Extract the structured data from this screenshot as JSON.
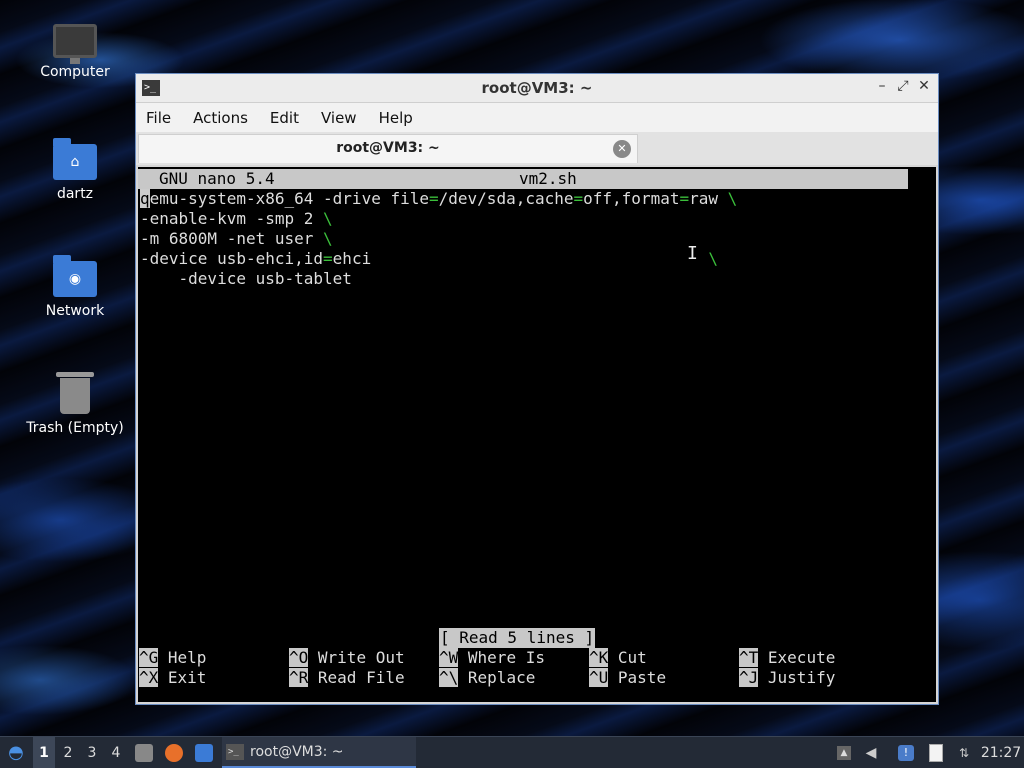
{
  "desktop": {
    "icons": [
      {
        "label": "Computer",
        "icon": "computer-icon"
      },
      {
        "label": "dartz",
        "icon": "home-folder-icon"
      },
      {
        "label": "Network",
        "icon": "network-folder-icon"
      },
      {
        "label": "Trash (Empty)",
        "icon": "trash-icon"
      }
    ]
  },
  "window": {
    "title": "root@VM3: ~",
    "controls": {
      "minimize": "–",
      "maximize": "⤢",
      "close": "✕"
    },
    "menu": [
      "File",
      "Actions",
      "Edit",
      "View",
      "Help"
    ],
    "tab": {
      "label": "root@VM3: ~",
      "close": "✕"
    }
  },
  "nano": {
    "version": "GNU nano 5.4",
    "filename": "vm2.sh",
    "lines": [
      "qemu-system-x86_64 -drive file=/dev/sda,cache=off,format=raw \\",
      "-enable-kvm -smp 2 \\",
      "-m 6800M -net user \\",
      "-device usb-ehci,id=ehci",
      "    -device usb-tablet"
    ],
    "status": "[ Read 5 lines ]",
    "shortcuts": [
      {
        "key": "^G",
        "label": "Help"
      },
      {
        "key": "^O",
        "label": "Write Out"
      },
      {
        "key": "^W",
        "label": "Where Is"
      },
      {
        "key": "^K",
        "label": "Cut"
      },
      {
        "key": "^T",
        "label": "Execute"
      },
      {
        "key": "^X",
        "label": "Exit"
      },
      {
        "key": "^R",
        "label": "Read File"
      },
      {
        "key": "^\\",
        "label": "Replace"
      },
      {
        "key": "^U",
        "label": "Paste"
      },
      {
        "key": "^J",
        "label": "Justify"
      }
    ]
  },
  "taskbar": {
    "workspaces": [
      "1",
      "2",
      "3",
      "4"
    ],
    "active_workspace": "1",
    "task_label": "root@VM3: ~",
    "clock": "21:27"
  },
  "colors": {
    "accent": "#5a8ad8",
    "nano_bar": "#c8c8c8",
    "highlight_green": "#3bbf3b"
  }
}
